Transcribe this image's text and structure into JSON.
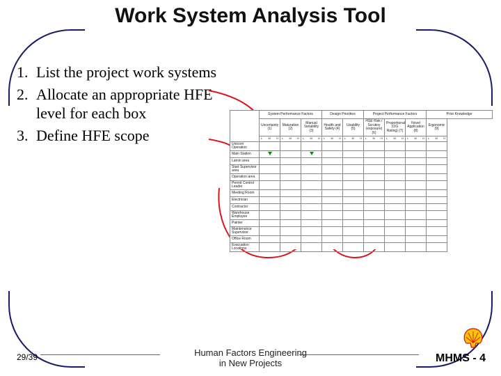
{
  "title": "Work System Analysis Tool",
  "steps": [
    "List the project work systems",
    "Allocate an appropriate HFE level for each box",
    "Define HFE scope"
  ],
  "matrix": {
    "groups": [
      {
        "label": "System Performance Factors",
        "span": 3
      },
      {
        "label": "Design Priorities",
        "span": 2
      },
      {
        "label": "Project Performance Factors",
        "span": 3
      },
      {
        "label": "Prior Knowledge",
        "span": 2
      }
    ],
    "subheaders": [
      "Uncertainty (1)",
      "Maturation (2)",
      "Manual Variability (3)",
      "Health and Safety (4)",
      "Usability (5)",
      "HSE Risk / Scrutiny (exposure) (6)",
      "Proportionality (OG Rating) (7)",
      "Novel Application (8)",
      "Ergonomic (9)"
    ],
    "sub_ids": [
      "1",
      "2",
      "3",
      "4",
      "5",
      "6",
      "7",
      "8",
      "9"
    ],
    "scale": {
      "a": "L",
      "b": "M",
      "c": "H"
    },
    "rows": [
      "Unicorn Operation",
      "Main Station",
      "Lamin area",
      "Start Supervisor area",
      "Operation area",
      "Permit Control Leader",
      "Meeting Room",
      "Electrician",
      "Contractor",
      "Warehouse Employee",
      "Painter",
      "Maintenance Supervisor",
      "Office Room",
      "Evacuation Locations"
    ]
  },
  "footer": {
    "page": "29/39",
    "center": "Human Factors Engineering\nin New Projects",
    "right": "MHMS - 4"
  },
  "chart_data": {
    "type": "table",
    "title": "Work System Analysis matrix (blank template)",
    "row_labels": [
      "Unicorn Operation",
      "Main Station",
      "Lamin area",
      "Start Supervisor area",
      "Operation area",
      "Permit Control Leader",
      "Meeting Room",
      "Electrician",
      "Contractor",
      "Warehouse Employee",
      "Painter",
      "Maintenance Supervisor",
      "Office Room",
      "Evacuation Locations"
    ],
    "column_groups": [
      {
        "label": "System Performance Factors",
        "columns": [
          "Uncertainty (1)",
          "Maturation (2)",
          "Manual Variability (3)"
        ]
      },
      {
        "label": "Design Priorities",
        "columns": [
          "Health and Safety (4)",
          "Usability (5)"
        ]
      },
      {
        "label": "Project Performance Factors",
        "columns": [
          "HSE Risk / Scrutiny (exposure) (6)",
          "Proportionality (OG Rating) (7)",
          "Novel Application (8)"
        ]
      },
      {
        "label": "Prior Knowledge",
        "columns": [
          "Ergonomic (9)"
        ]
      }
    ],
    "scale_per_column": [
      "L",
      "M",
      "H"
    ],
    "values": "blank"
  }
}
